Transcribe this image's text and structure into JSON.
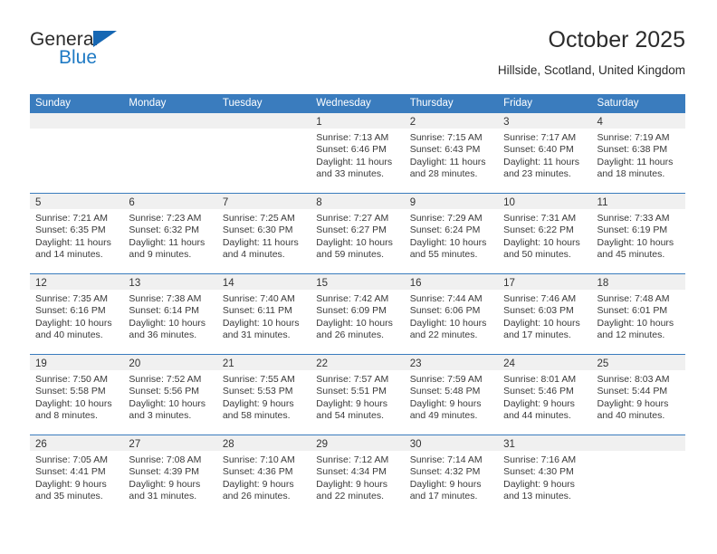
{
  "brand": {
    "name_part1": "General",
    "name_part2": "Blue",
    "triangle_icon": "triangle-icon",
    "accent_color": "#1f7ac4"
  },
  "header": {
    "title": "October 2025",
    "subtitle": "Hillside, Scotland, United Kingdom"
  },
  "theme": {
    "header_row_bg": "#3a7cbe",
    "daynum_band_bg": "#f0f0f0",
    "row_divider": "#3a7cbe",
    "text": "#3a3a3a"
  },
  "calendar": {
    "weekdays": [
      "Sunday",
      "Monday",
      "Tuesday",
      "Wednesday",
      "Thursday",
      "Friday",
      "Saturday"
    ],
    "labels": {
      "sunrise": "Sunrise:",
      "sunset": "Sunset:",
      "daylight": "Daylight:"
    },
    "weeks": [
      [
        {
          "day": "",
          "sunrise": "",
          "sunset": "",
          "daylight_line1": "",
          "daylight_line2": ""
        },
        {
          "day": "",
          "sunrise": "",
          "sunset": "",
          "daylight_line1": "",
          "daylight_line2": ""
        },
        {
          "day": "",
          "sunrise": "",
          "sunset": "",
          "daylight_line1": "",
          "daylight_line2": ""
        },
        {
          "day": "1",
          "sunrise": "Sunrise: 7:13 AM",
          "sunset": "Sunset: 6:46 PM",
          "daylight_line1": "Daylight: 11 hours",
          "daylight_line2": "and 33 minutes."
        },
        {
          "day": "2",
          "sunrise": "Sunrise: 7:15 AM",
          "sunset": "Sunset: 6:43 PM",
          "daylight_line1": "Daylight: 11 hours",
          "daylight_line2": "and 28 minutes."
        },
        {
          "day": "3",
          "sunrise": "Sunrise: 7:17 AM",
          "sunset": "Sunset: 6:40 PM",
          "daylight_line1": "Daylight: 11 hours",
          "daylight_line2": "and 23 minutes."
        },
        {
          "day": "4",
          "sunrise": "Sunrise: 7:19 AM",
          "sunset": "Sunset: 6:38 PM",
          "daylight_line1": "Daylight: 11 hours",
          "daylight_line2": "and 18 minutes."
        }
      ],
      [
        {
          "day": "5",
          "sunrise": "Sunrise: 7:21 AM",
          "sunset": "Sunset: 6:35 PM",
          "daylight_line1": "Daylight: 11 hours",
          "daylight_line2": "and 14 minutes."
        },
        {
          "day": "6",
          "sunrise": "Sunrise: 7:23 AM",
          "sunset": "Sunset: 6:32 PM",
          "daylight_line1": "Daylight: 11 hours",
          "daylight_line2": "and 9 minutes."
        },
        {
          "day": "7",
          "sunrise": "Sunrise: 7:25 AM",
          "sunset": "Sunset: 6:30 PM",
          "daylight_line1": "Daylight: 11 hours",
          "daylight_line2": "and 4 minutes."
        },
        {
          "day": "8",
          "sunrise": "Sunrise: 7:27 AM",
          "sunset": "Sunset: 6:27 PM",
          "daylight_line1": "Daylight: 10 hours",
          "daylight_line2": "and 59 minutes."
        },
        {
          "day": "9",
          "sunrise": "Sunrise: 7:29 AM",
          "sunset": "Sunset: 6:24 PM",
          "daylight_line1": "Daylight: 10 hours",
          "daylight_line2": "and 55 minutes."
        },
        {
          "day": "10",
          "sunrise": "Sunrise: 7:31 AM",
          "sunset": "Sunset: 6:22 PM",
          "daylight_line1": "Daylight: 10 hours",
          "daylight_line2": "and 50 minutes."
        },
        {
          "day": "11",
          "sunrise": "Sunrise: 7:33 AM",
          "sunset": "Sunset: 6:19 PM",
          "daylight_line1": "Daylight: 10 hours",
          "daylight_line2": "and 45 minutes."
        }
      ],
      [
        {
          "day": "12",
          "sunrise": "Sunrise: 7:35 AM",
          "sunset": "Sunset: 6:16 PM",
          "daylight_line1": "Daylight: 10 hours",
          "daylight_line2": "and 40 minutes."
        },
        {
          "day": "13",
          "sunrise": "Sunrise: 7:38 AM",
          "sunset": "Sunset: 6:14 PM",
          "daylight_line1": "Daylight: 10 hours",
          "daylight_line2": "and 36 minutes."
        },
        {
          "day": "14",
          "sunrise": "Sunrise: 7:40 AM",
          "sunset": "Sunset: 6:11 PM",
          "daylight_line1": "Daylight: 10 hours",
          "daylight_line2": "and 31 minutes."
        },
        {
          "day": "15",
          "sunrise": "Sunrise: 7:42 AM",
          "sunset": "Sunset: 6:09 PM",
          "daylight_line1": "Daylight: 10 hours",
          "daylight_line2": "and 26 minutes."
        },
        {
          "day": "16",
          "sunrise": "Sunrise: 7:44 AM",
          "sunset": "Sunset: 6:06 PM",
          "daylight_line1": "Daylight: 10 hours",
          "daylight_line2": "and 22 minutes."
        },
        {
          "day": "17",
          "sunrise": "Sunrise: 7:46 AM",
          "sunset": "Sunset: 6:03 PM",
          "daylight_line1": "Daylight: 10 hours",
          "daylight_line2": "and 17 minutes."
        },
        {
          "day": "18",
          "sunrise": "Sunrise: 7:48 AM",
          "sunset": "Sunset: 6:01 PM",
          "daylight_line1": "Daylight: 10 hours",
          "daylight_line2": "and 12 minutes."
        }
      ],
      [
        {
          "day": "19",
          "sunrise": "Sunrise: 7:50 AM",
          "sunset": "Sunset: 5:58 PM",
          "daylight_line1": "Daylight: 10 hours",
          "daylight_line2": "and 8 minutes."
        },
        {
          "day": "20",
          "sunrise": "Sunrise: 7:52 AM",
          "sunset": "Sunset: 5:56 PM",
          "daylight_line1": "Daylight: 10 hours",
          "daylight_line2": "and 3 minutes."
        },
        {
          "day": "21",
          "sunrise": "Sunrise: 7:55 AM",
          "sunset": "Sunset: 5:53 PM",
          "daylight_line1": "Daylight: 9 hours",
          "daylight_line2": "and 58 minutes."
        },
        {
          "day": "22",
          "sunrise": "Sunrise: 7:57 AM",
          "sunset": "Sunset: 5:51 PM",
          "daylight_line1": "Daylight: 9 hours",
          "daylight_line2": "and 54 minutes."
        },
        {
          "day": "23",
          "sunrise": "Sunrise: 7:59 AM",
          "sunset": "Sunset: 5:48 PM",
          "daylight_line1": "Daylight: 9 hours",
          "daylight_line2": "and 49 minutes."
        },
        {
          "day": "24",
          "sunrise": "Sunrise: 8:01 AM",
          "sunset": "Sunset: 5:46 PM",
          "daylight_line1": "Daylight: 9 hours",
          "daylight_line2": "and 44 minutes."
        },
        {
          "day": "25",
          "sunrise": "Sunrise: 8:03 AM",
          "sunset": "Sunset: 5:44 PM",
          "daylight_line1": "Daylight: 9 hours",
          "daylight_line2": "and 40 minutes."
        }
      ],
      [
        {
          "day": "26",
          "sunrise": "Sunrise: 7:05 AM",
          "sunset": "Sunset: 4:41 PM",
          "daylight_line1": "Daylight: 9 hours",
          "daylight_line2": "and 35 minutes."
        },
        {
          "day": "27",
          "sunrise": "Sunrise: 7:08 AM",
          "sunset": "Sunset: 4:39 PM",
          "daylight_line1": "Daylight: 9 hours",
          "daylight_line2": "and 31 minutes."
        },
        {
          "day": "28",
          "sunrise": "Sunrise: 7:10 AM",
          "sunset": "Sunset: 4:36 PM",
          "daylight_line1": "Daylight: 9 hours",
          "daylight_line2": "and 26 minutes."
        },
        {
          "day": "29",
          "sunrise": "Sunrise: 7:12 AM",
          "sunset": "Sunset: 4:34 PM",
          "daylight_line1": "Daylight: 9 hours",
          "daylight_line2": "and 22 minutes."
        },
        {
          "day": "30",
          "sunrise": "Sunrise: 7:14 AM",
          "sunset": "Sunset: 4:32 PM",
          "daylight_line1": "Daylight: 9 hours",
          "daylight_line2": "and 17 minutes."
        },
        {
          "day": "31",
          "sunrise": "Sunrise: 7:16 AM",
          "sunset": "Sunset: 4:30 PM",
          "daylight_line1": "Daylight: 9 hours",
          "daylight_line2": "and 13 minutes."
        },
        {
          "day": "",
          "sunrise": "",
          "sunset": "",
          "daylight_line1": "",
          "daylight_line2": ""
        }
      ]
    ]
  }
}
